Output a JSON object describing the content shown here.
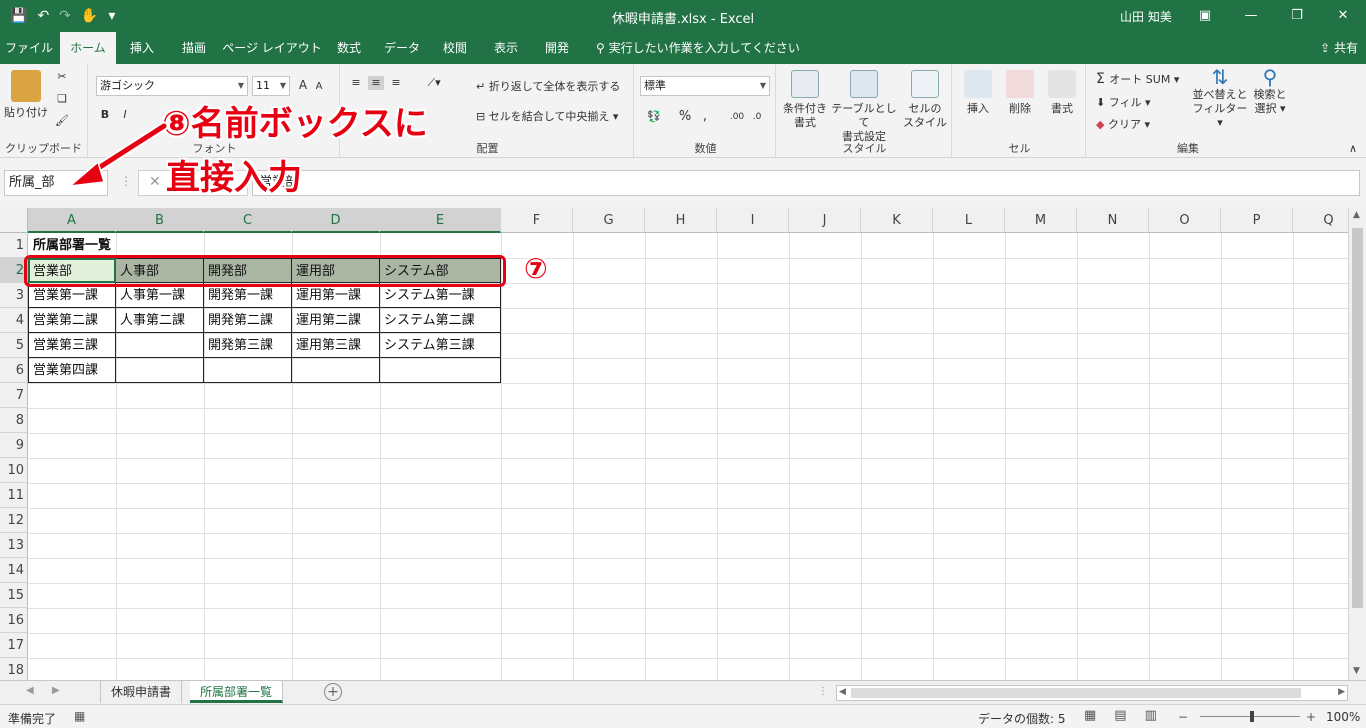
{
  "app": {
    "title": "休暇申請書.xlsx  -  Excel",
    "user": "山田 知美",
    "accent_color": "#217346"
  },
  "qat": {
    "save_icon": "save-icon",
    "undo_icon": "undo-icon",
    "redo_icon": "redo-icon",
    "touch_icon": "touch-mode-icon",
    "customize": "▾"
  },
  "ribbon_tabs": [
    "ファイル",
    "ホーム",
    "挿入",
    "描画",
    "ページ レイアウト",
    "数式",
    "データ",
    "校閲",
    "表示",
    "開発"
  ],
  "tell_me": "実行したい作業を入力してください",
  "share_label": "共有",
  "ribbon": {
    "clipboard": {
      "paste": "貼り付け",
      "label": "クリップボード"
    },
    "font": {
      "name": "游ゴシック",
      "size": "11",
      "label": "フォント"
    },
    "alignment": {
      "wrap": "折り返して全体を表示する",
      "merge": "セルを結合して中央揃え",
      "label": "配置"
    },
    "number": {
      "format": "標準",
      "label": "数値"
    },
    "styles": {
      "cond1": "条件付き",
      "cond2": "書式",
      "table1": "テーブルとして",
      "table2": "書式設定",
      "cell1": "セルの",
      "cell2": "スタイル",
      "label": "スタイル"
    },
    "cells": {
      "insert": "挿入",
      "delete": "削除",
      "format": "書式",
      "label": "セル"
    },
    "editing": {
      "autosum": "オート SUM",
      "fill": "フィル",
      "clear": "クリア",
      "sort1": "並べ替えと",
      "sort2": "フィルター",
      "find1": "検索と",
      "find2": "選択",
      "label": "編集"
    }
  },
  "formula_bar": {
    "name_box": "所属_部",
    "formula": "営業部"
  },
  "columns": [
    "A",
    "B",
    "C",
    "D",
    "E",
    "F",
    "G",
    "H",
    "I",
    "J",
    "K",
    "L",
    "M",
    "N",
    "O",
    "P",
    "Q"
  ],
  "rows": [
    "1",
    "2",
    "3",
    "4",
    "5",
    "6",
    "7",
    "8",
    "9",
    "10",
    "11",
    "12",
    "13",
    "14",
    "15",
    "16",
    "17",
    "18"
  ],
  "cells": {
    "a1": "所属部署一覧",
    "r2": [
      "営業部",
      "人事部",
      "開発部",
      "運用部",
      "システム部"
    ],
    "r3": [
      "営業第一課",
      "人事第一課",
      "開発第一課",
      "運用第一課",
      "システム第一課"
    ],
    "r4": [
      "営業第二課",
      "人事第二課",
      "開発第二課",
      "運用第二課",
      "システム第二課"
    ],
    "r5": [
      "営業第三課",
      "",
      "開発第三課",
      "運用第三課",
      "システム第三課"
    ],
    "r6": [
      "営業第四課",
      "",
      "",
      "",
      ""
    ]
  },
  "annotations": {
    "step8_line1": "⑧名前ボックスに",
    "step8_line2": "直接入力",
    "step7": "⑦",
    "color": "#e60012"
  },
  "sheet_tabs": [
    "休暇申請書",
    "所属部署一覧"
  ],
  "status": {
    "ready": "準備完了",
    "count": "データの個数: 5",
    "zoom": "100%"
  }
}
